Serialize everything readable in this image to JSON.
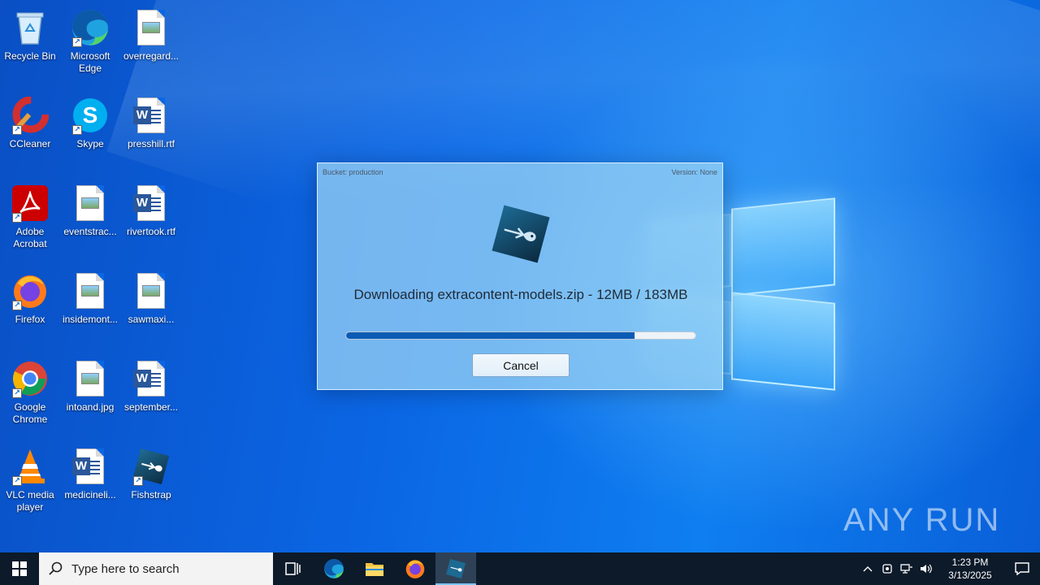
{
  "desktop": {
    "icons": [
      {
        "label": "Recycle Bin"
      },
      {
        "label": "Microsoft Edge"
      },
      {
        "label": "overregard..."
      },
      {
        "label": "CCleaner"
      },
      {
        "label": "Skype"
      },
      {
        "label": "presshill.rtf"
      },
      {
        "label": "Adobe Acrobat"
      },
      {
        "label": "eventstrac..."
      },
      {
        "label": "rivertook.rtf"
      },
      {
        "label": "Firefox"
      },
      {
        "label": "insidemont..."
      },
      {
        "label": "sawmaxi..."
      },
      {
        "label": "Google Chrome"
      },
      {
        "label": "intoand.jpg"
      },
      {
        "label": "september..."
      },
      {
        "label": "VLC media player"
      },
      {
        "label": "medicineli..."
      },
      {
        "label": "Fishstrap"
      }
    ]
  },
  "dialog": {
    "bucket": "Bucket: production",
    "version": "Version: None",
    "status": "Downloading extracontent-models.zip - 12MB / 183MB",
    "progress": 0.825,
    "cancel_label": "Cancel"
  },
  "watermark": "ANY RUN",
  "taskbar": {
    "search_placeholder": "Type here to search",
    "time": "1:23 PM",
    "date": "3/13/2025"
  },
  "colors": {
    "progress_fill": "#0a5bb5",
    "taskbar_bg": "#0c1a2a"
  }
}
